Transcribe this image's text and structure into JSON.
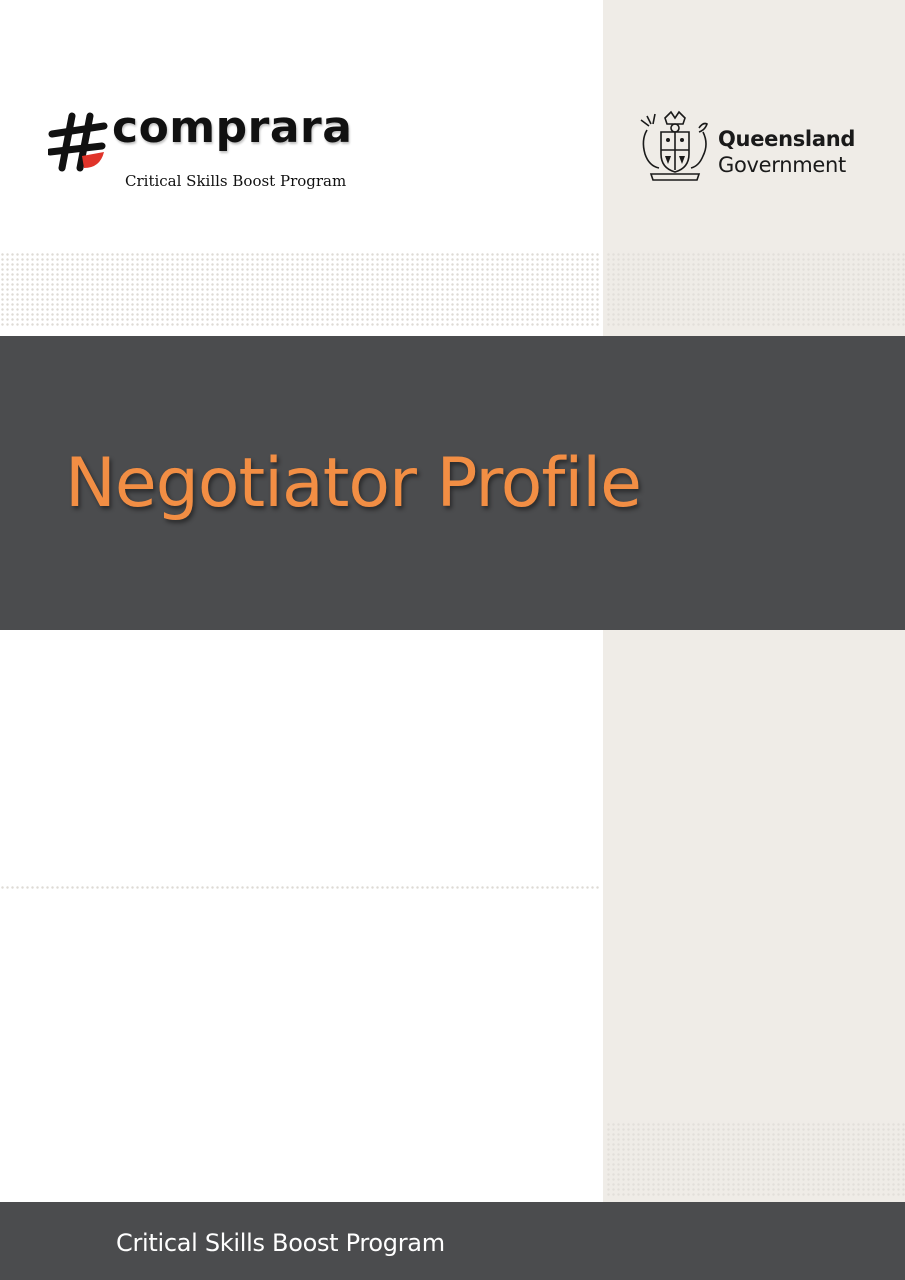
{
  "branding": {
    "program_logo": {
      "wordmark": "comprara",
      "tagline": "Critical Skills Boost Program",
      "icon": "hashtag-icon",
      "accent_color": "#e0342a"
    },
    "government_logo": {
      "line1": "Queensland",
      "line2": "Government",
      "icon": "coat-of-arms-icon"
    }
  },
  "cover": {
    "title": "Negotiator Profile",
    "title_color": "#f28e44",
    "band_color": "#4b4c4e",
    "panel_color": "#efece7"
  },
  "footer": {
    "text": "Critical Skills Boost Program"
  }
}
